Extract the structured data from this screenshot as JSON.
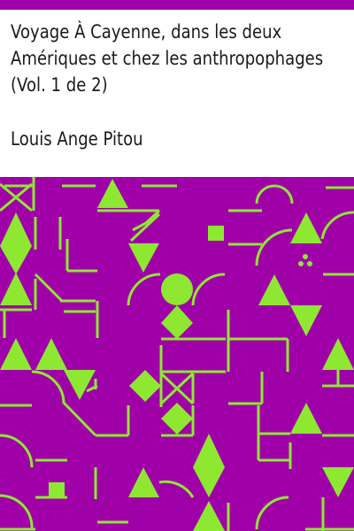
{
  "cover": {
    "title_lines": [
      "Voyage À  Cayenne, dans les deux",
      "Amériques et chez les anthropophages",
      "(Vol. 1 de 2)"
    ],
    "author": "Louis Ange Pitou",
    "colors": {
      "banner": "#a000a8",
      "pattern_background": "#a000a8",
      "pattern_shapes": "#8ee832",
      "text": "#1a1a1a",
      "page": "#ffffff"
    }
  }
}
